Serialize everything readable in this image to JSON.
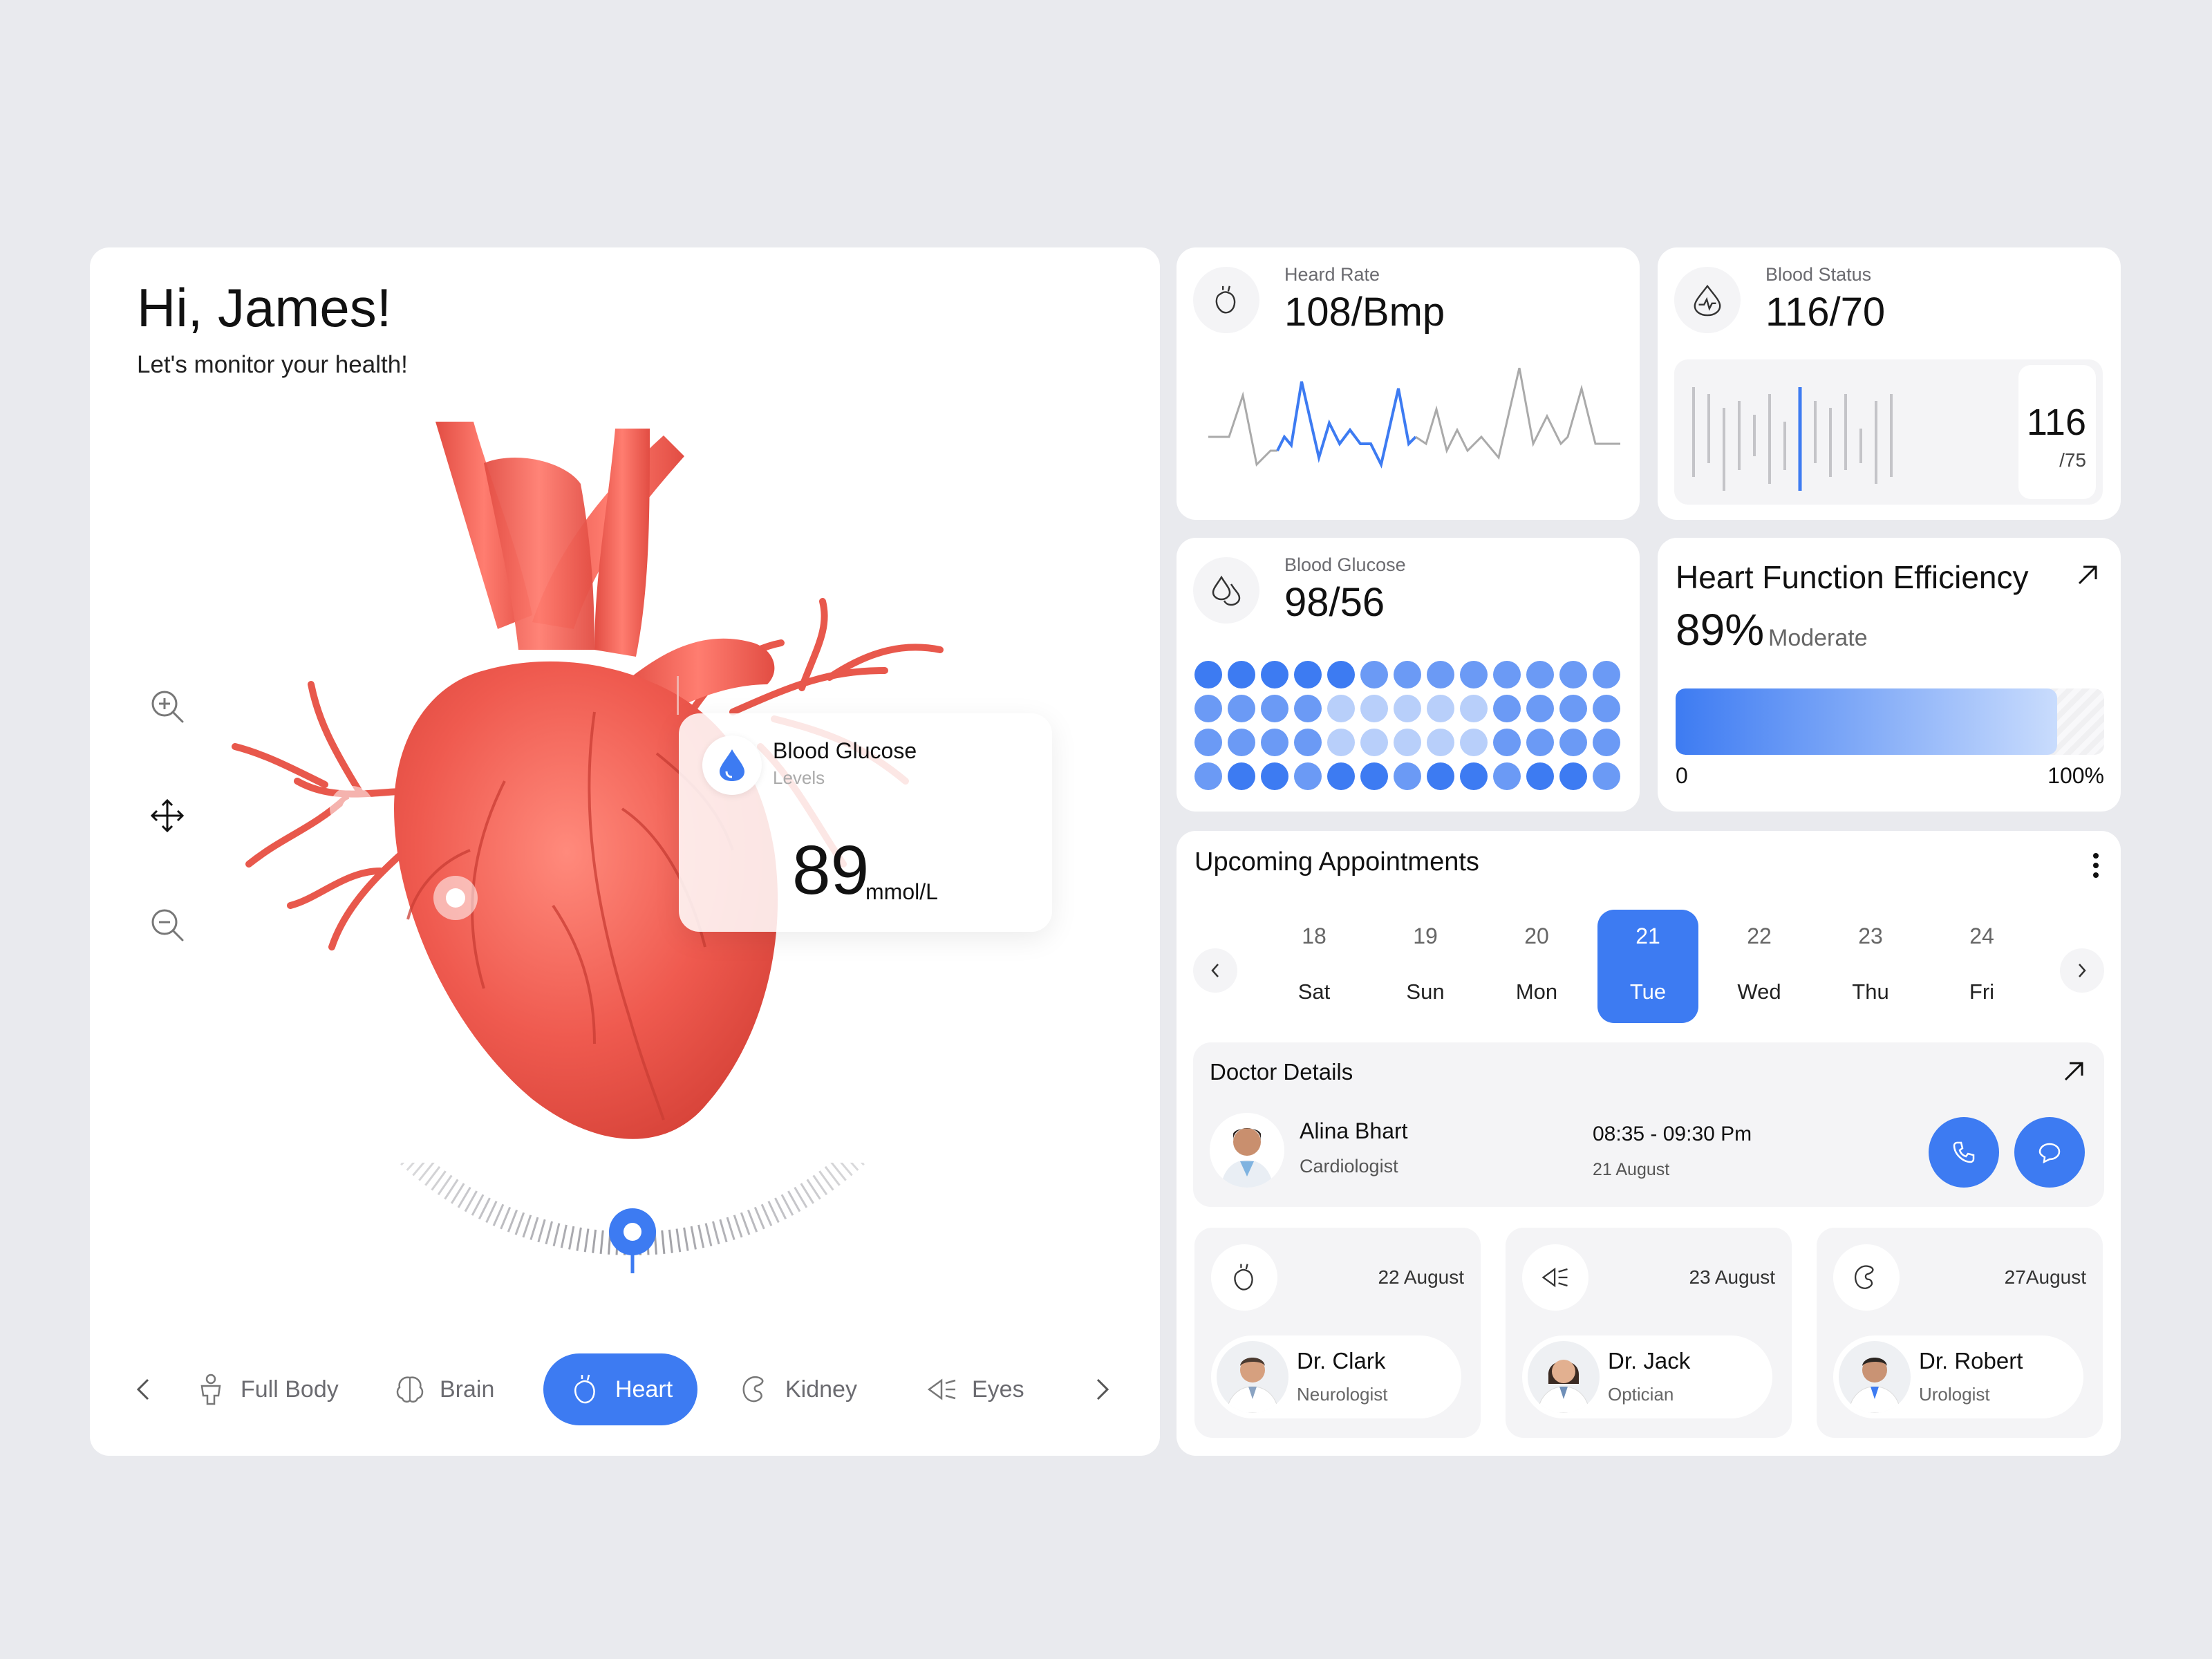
{
  "greeting": {
    "title": "Hi, James!",
    "subtitle": "Let's monitor your health!"
  },
  "popup": {
    "title": "Blood Glucose",
    "subtitle": "Levels",
    "value": "89",
    "unit": "mmol/L"
  },
  "body_nav": {
    "items": [
      {
        "label": "Full Body",
        "icon": "body-icon"
      },
      {
        "label": "Brain",
        "icon": "brain-icon"
      },
      {
        "label": "Heart",
        "icon": "heart-icon",
        "active": true
      },
      {
        "label": "Kidney",
        "icon": "kidney-icon"
      },
      {
        "label": "Eyes",
        "icon": "eye-icon"
      }
    ]
  },
  "heart_rate": {
    "label": "Heard Rate",
    "value": "108/Bmp"
  },
  "blood_status": {
    "label": "Blood Status",
    "value": "116/70",
    "side_value": "116",
    "side_sub": "/75"
  },
  "blood_glucose": {
    "label": "Blood Glucose",
    "value": "98/56"
  },
  "efficiency": {
    "title": "Heart Function Efficiency",
    "value": "89%",
    "status": "Moderate",
    "level": 0.89,
    "min_label": "0",
    "max_label": "100%"
  },
  "appointments": {
    "title": "Upcoming Appointments",
    "days": [
      {
        "num": "18",
        "name": "Sat"
      },
      {
        "num": "19",
        "name": "Sun"
      },
      {
        "num": "20",
        "name": "Mon"
      },
      {
        "num": "21",
        "name": "Tue",
        "active": true
      },
      {
        "num": "22",
        "name": "Wed"
      },
      {
        "num": "23",
        "name": "Thu"
      },
      {
        "num": "24",
        "name": "Fri"
      }
    ],
    "doctor_details": {
      "title": "Doctor Details",
      "name": "Alina Bhart",
      "role": "Cardiologist",
      "time": "08:35 - 09:30 Pm",
      "date": "21 August"
    },
    "upcoming": [
      {
        "date": "22 August",
        "name": "Dr. Clark",
        "role": "Neurologist",
        "icon": "heart-icon"
      },
      {
        "date": "23 August",
        "name": "Dr. Jack",
        "role": "Optician",
        "icon": "eye-icon"
      },
      {
        "date": "27August",
        "name": "Dr. Robert",
        "role": "Urologist",
        "icon": "kidney-icon"
      }
    ]
  },
  "colors": {
    "accent": "#3d7bf2",
    "heart": "#ef5a4f",
    "background": "#e9eaee"
  }
}
